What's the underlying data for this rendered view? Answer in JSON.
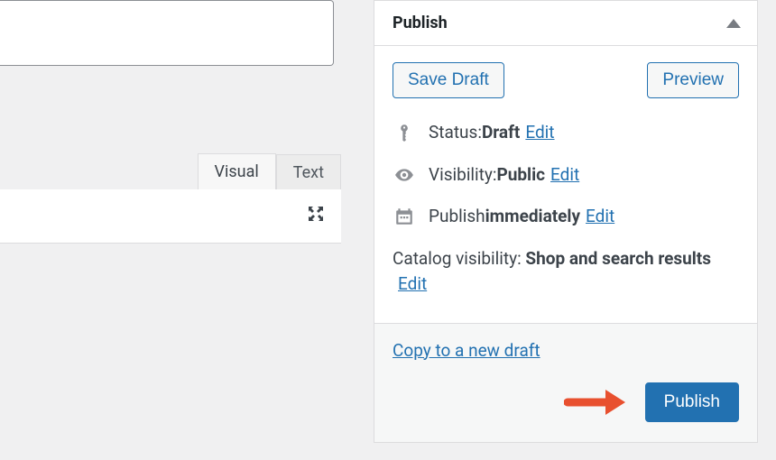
{
  "editor": {
    "tabs": {
      "visual": "Visual",
      "text": "Text"
    }
  },
  "publish": {
    "panel_title": "Publish",
    "save_draft": "Save Draft",
    "preview": "Preview",
    "status": {
      "label": "Status: ",
      "value": "Draft",
      "edit": "Edit"
    },
    "visibility": {
      "label": "Visibility: ",
      "value": "Public",
      "edit": "Edit"
    },
    "schedule": {
      "prefix": "Publish ",
      "value": "immediately",
      "edit": "Edit"
    },
    "catalog": {
      "label": "Catalog visibility: ",
      "value": "Shop and search results",
      "edit": "Edit"
    },
    "copy_link": "Copy to a new draft",
    "publish_button": "Publish"
  }
}
